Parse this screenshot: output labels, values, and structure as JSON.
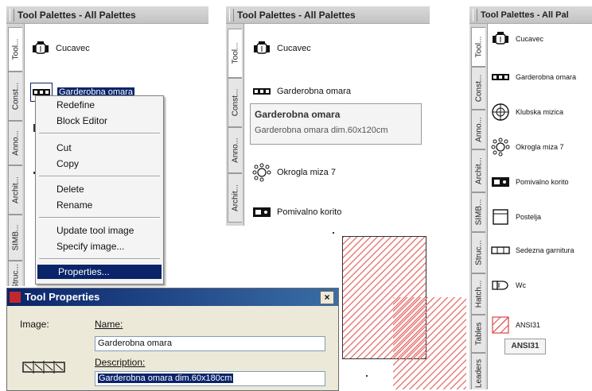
{
  "palette1": {
    "title": "Tool Palettes - All Palettes",
    "tabs": [
      "Tool...",
      "Const...",
      "Anno...",
      "Archit...",
      "SIMB...",
      "Struc..."
    ],
    "items": [
      "Cucavec",
      "Garderobna omara"
    ],
    "context_menu": [
      "Redefine",
      "Block Editor",
      "Cut",
      "Copy",
      "Delete",
      "Rename",
      "Update tool image",
      "Specify image...",
      "Properties..."
    ]
  },
  "palette2": {
    "title": "Tool Palettes - All Palettes",
    "tabs": [
      "Tool...",
      "Const...",
      "Anno...",
      "Archit..."
    ],
    "items": [
      "Cucavec",
      "Garderobna omara",
      "Okrogla miza 7",
      "Pomivalno korito"
    ],
    "tooltip": {
      "title": "Garderobna omara",
      "description": "Garderobna omara dim.60x120cm"
    }
  },
  "palette3": {
    "title": "Tool Palettes - All Pal",
    "tabs": [
      "Tool...",
      "Const...",
      "Anno...",
      "Archit...",
      "SIMB...",
      "Struc...",
      "Hatch...",
      "Tables",
      "Leaders"
    ],
    "items": [
      "Cucavec",
      "Garderobna omara",
      "Klubska mizica",
      "Okrogla miza 7",
      "Pomivalno korito",
      "Postelja",
      "Sedezna garnitura",
      "Wc",
      "ANSI31"
    ],
    "tooltip": "ANSI31"
  },
  "dialog": {
    "title": "Tool Properties",
    "close": "×",
    "image_label": "Image:",
    "name_label": "Name:",
    "name_value": "Garderobna omara",
    "description_label": "Description:",
    "description_value": "Garderobna omara dim.60x180cm"
  },
  "colors": {
    "selection": "#0a246a",
    "hatch": "#e87a7a"
  }
}
